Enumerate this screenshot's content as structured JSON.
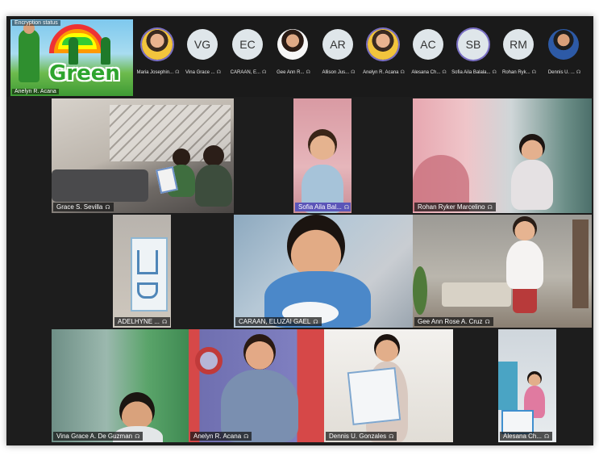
{
  "share_panel": {
    "status_text": "Encryption status",
    "presenter_name": "Anelyn R. Acana",
    "slide_word": "Green"
  },
  "participants": [
    {
      "name": "Maria Josephin...",
      "initials": "",
      "avatar": "photo"
    },
    {
      "name": "Vina Grace ...",
      "initials": "VG",
      "avatar": "initials"
    },
    {
      "name": "CARAAN, E...",
      "initials": "EC",
      "avatar": "initials"
    },
    {
      "name": "Gee Ann R...",
      "initials": "",
      "avatar": "photo"
    },
    {
      "name": "Allison Jus...",
      "initials": "AR",
      "avatar": "initials"
    },
    {
      "name": "Anelyn R. Acana",
      "initials": "",
      "avatar": "photo"
    },
    {
      "name": "Alesana Ch...",
      "initials": "AC",
      "avatar": "initials"
    },
    {
      "name": "Sofia Aila Balala...",
      "initials": "SB",
      "avatar": "initials"
    },
    {
      "name": "Rohan Ryk...",
      "initials": "RM",
      "avatar": "initials"
    },
    {
      "name": "Dennis U. ...",
      "initials": "",
      "avatar": "photo"
    }
  ],
  "tiles": [
    {
      "name": "Grace S. Sevilla"
    },
    {
      "name": "Sofia Aila Bal..."
    },
    {
      "name": "Rohan Ryker Marcelino"
    },
    {
      "name": "ADELHYNE ..."
    },
    {
      "name": "CARAAN, ELUZAI GAEL"
    },
    {
      "name": "Gee Ann Rose A. Cruz"
    },
    {
      "name": "Vina Grace A. De Guzman"
    },
    {
      "name": "Anelyn R. Acana"
    },
    {
      "name": "Dennis U. Gonzales"
    },
    {
      "name": "Alesana Ch..."
    }
  ],
  "icons": {
    "mic": "microphone-icon"
  },
  "colors": {
    "active_speaker_label": "#5b55b8",
    "background": "#1d1d1d"
  }
}
